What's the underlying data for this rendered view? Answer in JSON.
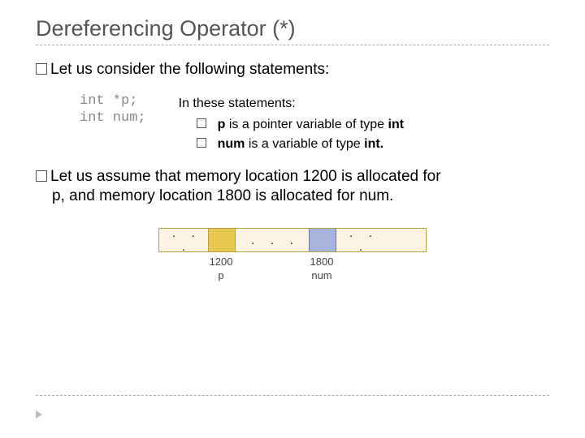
{
  "title": "Dereferencing Operator (*)",
  "bullet1": {
    "prefix": "Let",
    "rest": " us consider the following statements:"
  },
  "code": {
    "line1": "int *p;",
    "line2": "int num;"
  },
  "inthese": {
    "header": "In these statements:",
    "item1_pre": "p",
    "item1_mid": " is a pointer variable of type ",
    "item1_post": "int",
    "item2_pre": "num",
    "item2_mid": " is a variable of type ",
    "item2_post": "int."
  },
  "bullet2": {
    "prefix": "Let",
    "rest1": " us assume that memory location 1200 is allocated for",
    "rest2": "p, and memory location 1800 is allocated for num."
  },
  "mem": {
    "dots": ". . .",
    "addr_p": "1200",
    "addr_num": "1800",
    "name_p": "p",
    "name_num": "num"
  }
}
